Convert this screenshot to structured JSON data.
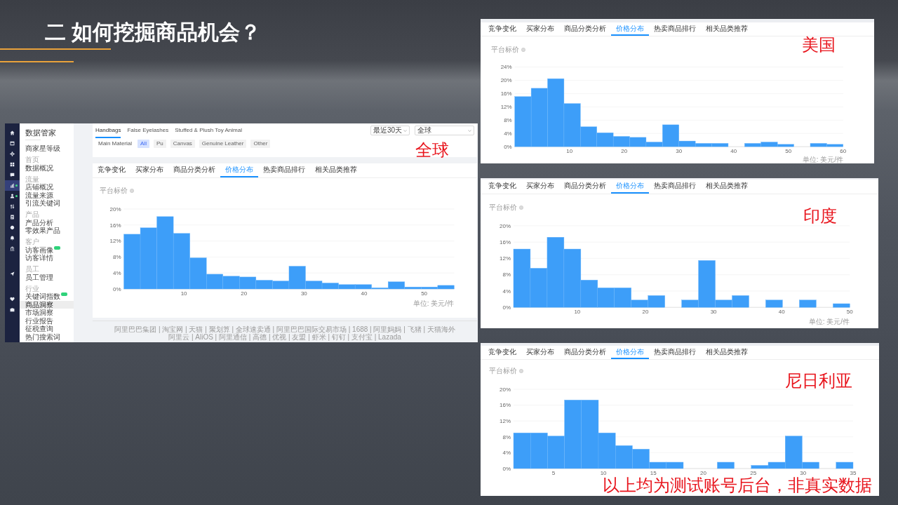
{
  "slide": {
    "title": "二 如何挖掘商品机会？"
  },
  "left_screenshot": {
    "icon_rail": [
      {
        "items": [
          {
            "selected": false,
            "dot": false
          },
          {
            "selected": false,
            "dot": false
          },
          {
            "selected": false,
            "dot": false
          },
          {
            "selected": false,
            "dot": false
          },
          {
            "selected": false,
            "dot": false
          },
          {
            "selected": true,
            "dot": true
          },
          {
            "selected": false,
            "dot": true
          },
          {
            "selected": false,
            "dot": false
          },
          {
            "selected": false,
            "dot": false
          },
          {
            "selected": false,
            "dot": false
          },
          {
            "selected": false,
            "dot": false
          },
          {
            "selected": false,
            "dot": false
          }
        ]
      },
      {
        "items": [
          {
            "selected": false,
            "dot": false
          }
        ]
      },
      {
        "items": [
          {
            "selected": false,
            "dot": false
          },
          {
            "selected": false,
            "dot": false
          }
        ]
      }
    ],
    "sidebar": {
      "title": "数据管家",
      "sections": [
        {
          "items": [
            {
              "label": "商家星等级",
              "selected": false,
              "new_badge": false
            }
          ]
        },
        {
          "header": "首页",
          "items": [
            {
              "label": "数据概况",
              "selected": false,
              "new_badge": false
            }
          ]
        },
        {
          "header": "流量",
          "items": [
            {
              "label": "店铺概况",
              "selected": false,
              "new_badge": false
            },
            {
              "label": "流量来源",
              "selected": false,
              "new_badge": false
            },
            {
              "label": "引流关键词",
              "selected": false,
              "new_badge": false
            }
          ]
        },
        {
          "header": "产品",
          "items": [
            {
              "label": "产品分析",
              "selected": false,
              "new_badge": false
            },
            {
              "label": "零效果产品",
              "selected": false,
              "new_badge": false
            }
          ]
        },
        {
          "header": "客户",
          "items": [
            {
              "label": "访客画像",
              "selected": false,
              "new_badge": true
            },
            {
              "label": "访客详情",
              "selected": false,
              "new_badge": false
            }
          ]
        },
        {
          "header": "员工",
          "items": [
            {
              "label": "员工管理",
              "selected": false,
              "new_badge": false
            }
          ]
        },
        {
          "header": "行业",
          "items": [
            {
              "label": "关键词指数",
              "selected": false,
              "new_badge": true
            },
            {
              "label": "商品洞察",
              "selected": true,
              "new_badge": false
            },
            {
              "label": "市场洞察",
              "selected": false,
              "new_badge": false
            },
            {
              "label": "行业报告",
              "selected": false,
              "new_badge": false
            },
            {
              "label": "征税查询",
              "selected": false,
              "new_badge": false
            },
            {
              "label": "热门搜索词",
              "selected": false,
              "new_badge": false
            }
          ]
        }
      ]
    },
    "category_tabs": [
      {
        "label": "Handbags",
        "selected": true
      },
      {
        "label": "False Eyelashes",
        "selected": false
      },
      {
        "label": "Stuffed & Plush Toy Animal",
        "selected": false
      }
    ],
    "dropdowns": [
      {
        "value": "最近30天"
      },
      {
        "value": "全球"
      }
    ],
    "material_filter": {
      "label": "Main Material",
      "options": [
        {
          "label": "All",
          "selected": true
        },
        {
          "label": "Pu",
          "selected": false
        },
        {
          "label": "Canvas",
          "selected": false
        },
        {
          "label": "Genuine Leather",
          "selected": false
        },
        {
          "label": "Other",
          "selected": false
        }
      ]
    },
    "annotation": "全球",
    "tabs": [
      {
        "label": "竞争变化",
        "selected": false
      },
      {
        "label": "买家分布",
        "selected": false
      },
      {
        "label": "商品分类分析",
        "selected": false
      },
      {
        "label": "价格分布",
        "selected": true
      },
      {
        "label": "热卖商品排行",
        "selected": false
      },
      {
        "label": "相关品类推荐",
        "selected": false
      }
    ],
    "chart_data": {
      "type": "bar",
      "title": "平台标价",
      "xlabel": "单位: 美元/件",
      "grid": true,
      "x": [
        1.375,
        4.125,
        6.875,
        9.625,
        12.375,
        15.125,
        17.875,
        20.625,
        23.375,
        26.125,
        28.875,
        31.625,
        34.375,
        37.125,
        39.875,
        42.625,
        45.375,
        48.125,
        50.875,
        53.625
      ],
      "values": [
        13.7,
        15.3,
        18.1,
        13.9,
        7.8,
        3.7,
        3.2,
        3.0,
        2.2,
        2.0,
        5.7,
        2.0,
        1.5,
        1.1,
        1.1,
        0.3,
        1.8,
        0.5,
        0.5,
        0.9
      ],
      "xlim": [
        0,
        55
      ],
      "ylim": [
        0,
        20
      ],
      "xticks": [
        10,
        20,
        30,
        40,
        50
      ],
      "yticks": [
        {
          "value": 0,
          "label": "0%"
        },
        {
          "value": 4,
          "label": "4%"
        },
        {
          "value": 8,
          "label": "8%"
        },
        {
          "value": 12,
          "label": "12%"
        },
        {
          "value": 16,
          "label": "16%"
        },
        {
          "value": 20,
          "label": "20%"
        }
      ]
    },
    "footer": {
      "lines": [
        "阿里巴巴集团 | 淘宝网 | 天猫 | 聚划算 | 全球速卖通 | 阿里巴巴国际交易市场 | 1688 | 阿里妈妈 | 飞猪 | 天猫海外",
        "阿里云 | AliOS | 阿里通信 | 高德 | 优视 | 友盟 | 虾米 | 钉钉 | 支付宝 | Lazada"
      ]
    }
  },
  "right_screenshots": [
    {
      "tabs": [
        {
          "label": "竞争变化",
          "selected": false
        },
        {
          "label": "买家分布",
          "selected": false
        },
        {
          "label": "商品分类分析",
          "selected": false
        },
        {
          "label": "价格分布",
          "selected": true
        },
        {
          "label": "热卖商品排行",
          "selected": false
        },
        {
          "label": "相关品类推荐",
          "selected": false
        }
      ],
      "annotation": "美国",
      "chart_data": {
        "type": "bar",
        "title": "平台标价",
        "xlabel": "单位: 美元/件",
        "grid": true,
        "x": [
          1.5,
          4.5,
          7.5,
          10.5,
          13.5,
          16.5,
          19.5,
          22.5,
          25.5,
          28.5,
          31.5,
          34.5,
          37.5,
          40.5,
          43.5,
          46.5,
          49.5,
          52.5,
          55.5,
          58.5
        ],
        "values": [
          15.1,
          17.6,
          20.5,
          13.0,
          6.0,
          4.2,
          3.1,
          2.8,
          1.4,
          6.6,
          1.7,
          1.0,
          1.0,
          0,
          1.0,
          1.4,
          0.7,
          0,
          1.0,
          0.7
        ],
        "xlim": [
          0,
          60
        ],
        "ylim": [
          0,
          24
        ],
        "xticks": [
          10,
          20,
          30,
          40,
          50,
          60
        ],
        "yticks": [
          {
            "value": 0,
            "label": "0%"
          },
          {
            "value": 4,
            "label": "4%"
          },
          {
            "value": 8,
            "label": "8%"
          },
          {
            "value": 12,
            "label": "12%"
          },
          {
            "value": 16,
            "label": "16%"
          },
          {
            "value": 20,
            "label": "20%"
          },
          {
            "value": 24,
            "label": "24%"
          }
        ]
      }
    },
    {
      "tabs": [
        {
          "label": "竞争变化",
          "selected": false
        },
        {
          "label": "买家分布",
          "selected": false
        },
        {
          "label": "商品分类分析",
          "selected": false
        },
        {
          "label": "价格分布",
          "selected": true
        },
        {
          "label": "热卖商品排行",
          "selected": false
        },
        {
          "label": "相关品类推荐",
          "selected": false
        }
      ],
      "annotation": "印度",
      "chart_data": {
        "type": "bar",
        "title": "平台标价",
        "xlabel": "单位: 美元/件",
        "grid": true,
        "x": [
          1.87,
          4.34,
          6.81,
          9.28,
          11.75,
          14.21,
          16.68,
          19.15,
          21.62,
          24.09,
          26.55,
          29.02,
          31.49,
          33.96,
          36.43,
          38.89,
          41.36,
          43.83,
          46.3,
          48.77
        ],
        "values": [
          14.3,
          9.6,
          17.2,
          14.3,
          6.7,
          4.8,
          4.8,
          1.8,
          2.9,
          0,
          1.8,
          11.5,
          1.8,
          2.9,
          0,
          1.8,
          0,
          1.8,
          0,
          0.9
        ],
        "xlim": [
          0.64,
          50
        ],
        "ylim": [
          0,
          20
        ],
        "xticks": [
          10,
          20,
          30,
          40,
          50
        ],
        "yticks": [
          {
            "value": 0,
            "label": "0%"
          },
          {
            "value": 4,
            "label": "4%"
          },
          {
            "value": 8,
            "label": "8%"
          },
          {
            "value": 12,
            "label": "12%"
          },
          {
            "value": 16,
            "label": "16%"
          },
          {
            "value": 20,
            "label": "20%"
          }
        ]
      }
    },
    {
      "tabs": [
        {
          "label": "竞争变化",
          "selected": false
        },
        {
          "label": "买家分布",
          "selected": false
        },
        {
          "label": "商品分类分析",
          "selected": false
        },
        {
          "label": "价格分布",
          "selected": true
        },
        {
          "label": "热卖商品排行",
          "selected": false
        },
        {
          "label": "相关品类推荐",
          "selected": false
        }
      ],
      "annotation": "尼日利亚",
      "chart_data": {
        "type": "bar",
        "title": "平台标价",
        "grid": true,
        "x": [
          1.85,
          3.55,
          5.25,
          6.95,
          8.65,
          10.35,
          12.05,
          13.75,
          15.45,
          17.15,
          18.85,
          20.55,
          22.25,
          23.95,
          25.65,
          27.35,
          29.05,
          30.75,
          32.45,
          34.15
        ],
        "values": [
          9.0,
          9.0,
          8.2,
          17.3,
          17.3,
          9.0,
          5.8,
          4.9,
          1.6,
          1.6,
          0,
          0,
          1.6,
          0,
          0.8,
          1.6,
          8.2,
          1.6,
          0,
          1.6
        ],
        "xlim": [
          1,
          35
        ],
        "ylim": [
          0,
          20
        ],
        "xticks": [
          5,
          10,
          15,
          20,
          25,
          30,
          35
        ],
        "yticks": [
          {
            "value": 0,
            "label": "0%"
          },
          {
            "value": 4,
            "label": "4%"
          },
          {
            "value": 8,
            "label": "8%"
          },
          {
            "value": 12,
            "label": "12%"
          },
          {
            "value": 16,
            "label": "16%"
          },
          {
            "value": 20,
            "label": "20%"
          }
        ]
      }
    }
  ],
  "note": "以上均为测试账号后台，非真实数据"
}
